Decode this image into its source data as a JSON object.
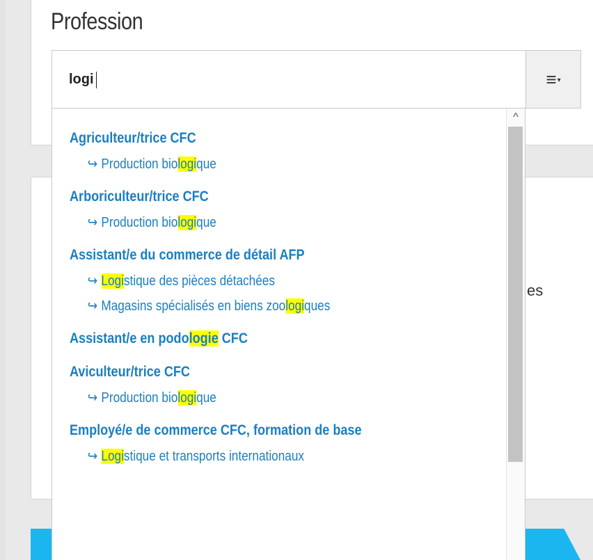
{
  "field": {
    "label": "Profession",
    "input_value": "logi",
    "clear_icon": "×",
    "menu_icon": "≡▾"
  },
  "background": {
    "partial_text": "es"
  },
  "scrollbar": {
    "up_icon": "^"
  },
  "results": [
    {
      "profession": [
        [
          "Agriculteur/trice CFC",
          false
        ]
      ],
      "specializations": [
        [
          [
            "Production bio",
            false
          ],
          [
            "logi",
            true
          ],
          [
            "que",
            false
          ]
        ]
      ]
    },
    {
      "profession": [
        [
          "Arboriculteur/trice CFC",
          false
        ]
      ],
      "specializations": [
        [
          [
            "Production bio",
            false
          ],
          [
            "logi",
            true
          ],
          [
            "que",
            false
          ]
        ]
      ]
    },
    {
      "profession": [
        [
          "Assistant/e du commerce de détail AFP",
          false
        ]
      ],
      "specializations": [
        [
          [
            "Logi",
            true
          ],
          [
            "stique des pièces détachées",
            false
          ]
        ],
        [
          [
            "Magasins spécialisés en biens zoo",
            false
          ],
          [
            "logi",
            true
          ],
          [
            "ques",
            false
          ]
        ]
      ]
    },
    {
      "profession": [
        [
          "Assistant/e en podo",
          false
        ],
        [
          "logie",
          true
        ],
        [
          " CFC",
          false
        ]
      ],
      "specializations": []
    },
    {
      "profession": [
        [
          "Aviculteur/trice CFC",
          false
        ]
      ],
      "specializations": [
        [
          [
            "Production bio",
            false
          ],
          [
            "logi",
            true
          ],
          [
            "que",
            false
          ]
        ]
      ]
    },
    {
      "profession": [
        [
          "Employé/e de commerce CFC, formation de base",
          false
        ]
      ],
      "specializations": [
        [
          [
            "Logi",
            true
          ],
          [
            "stique et transports internationaux",
            false
          ]
        ]
      ]
    }
  ],
  "arrow_glyph": "↪",
  "colors": {
    "link": "#1a7fc1",
    "highlight": "#ffff00",
    "accent_bar": "#1bb6f0"
  }
}
